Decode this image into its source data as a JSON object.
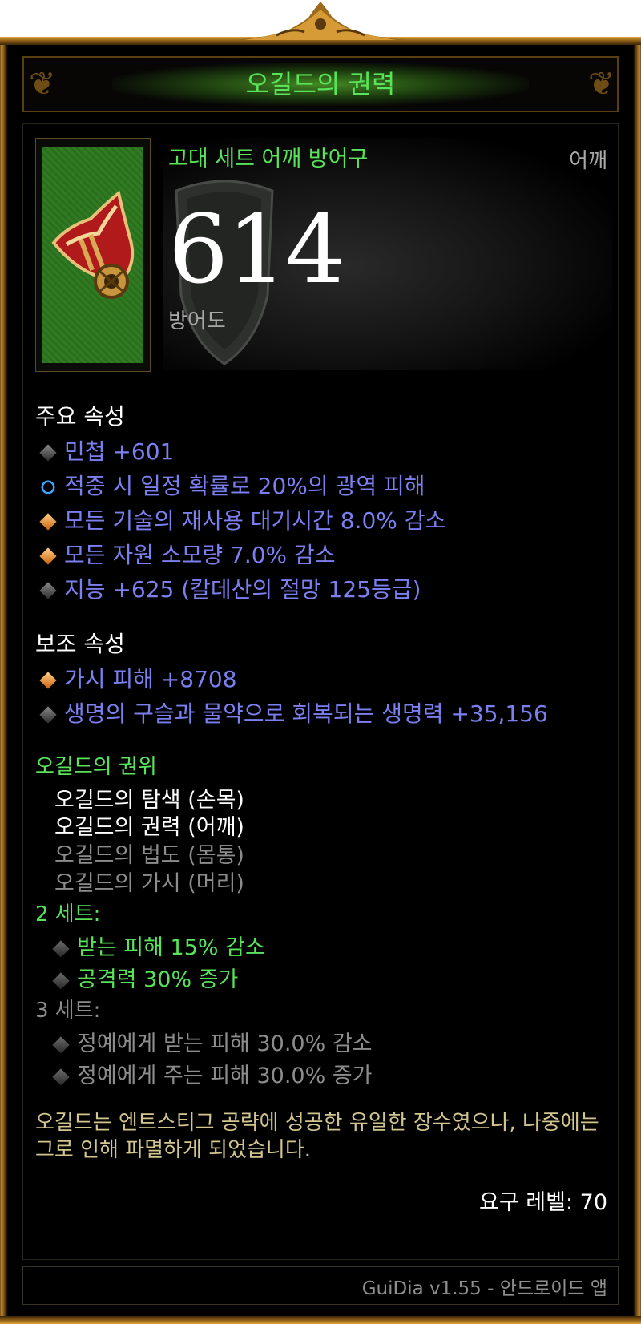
{
  "item": {
    "name": "오길드의 권력",
    "type": "고대 세트 어깨 방어구",
    "slot": "어깨",
    "armor_value": "614",
    "armor_label": "방어도"
  },
  "primary": {
    "title": "주요 속성",
    "props": [
      {
        "text": "민첩 +601",
        "bullet": "gray-diamond"
      },
      {
        "text": "적중 시 일정 확률로 20%의 광역 피해",
        "bullet": "blue-circle"
      },
      {
        "text": "모든 기술의 재사용 대기시간 8.0% 감소",
        "bullet": "orange-diamond"
      },
      {
        "text": "모든 자원 소모량 7.0% 감소",
        "bullet": "orange-diamond"
      },
      {
        "text": "지능 +625 (칼데산의 절망 125등급)",
        "bullet": "gray-diamond"
      }
    ]
  },
  "secondary": {
    "title": "보조 속성",
    "props": [
      {
        "text": "가시 피해 +8708",
        "bullet": "orange-diamond"
      },
      {
        "text": "생명의 구슬과 물약으로 회복되는 생명력 +35,156",
        "bullet": "gray-diamond"
      }
    ]
  },
  "set": {
    "title": "오길드의 권위",
    "pieces": [
      {
        "text": "오길드의 탐색 (손목)",
        "owned": true
      },
      {
        "text": "오길드의 권력 (어깨)",
        "owned": true
      },
      {
        "text": "오길드의 법도 (몸통)",
        "owned": false
      },
      {
        "text": "오길드의 가시 (머리)",
        "owned": false
      }
    ],
    "bonus2": {
      "label": "2 세트:",
      "items": [
        "받는 피해 15% 감소",
        "공격력 30% 증가"
      ]
    },
    "bonus3": {
      "label": "3 세트:",
      "items": [
        "정예에게 받는 피해 30.0% 감소",
        "정예에게 주는 피해 30.0% 증가"
      ]
    }
  },
  "flavor_text": "오길드는 엔트스티그 공략에 성공한 유일한 장수였으나, 나중에는 그로 인해 파멸하게 되었습니다.",
  "required_level": "요구 레벨: 70",
  "footer": "GuiDia v1.55 - 안드로이드 앱",
  "colors": {
    "set_green": "#58e35a",
    "magic_blue": "#7b7ff0",
    "inactive_gray": "#8c8c8c",
    "flavor_gold": "#d3c58e",
    "frame_gold": "#c9922c"
  }
}
